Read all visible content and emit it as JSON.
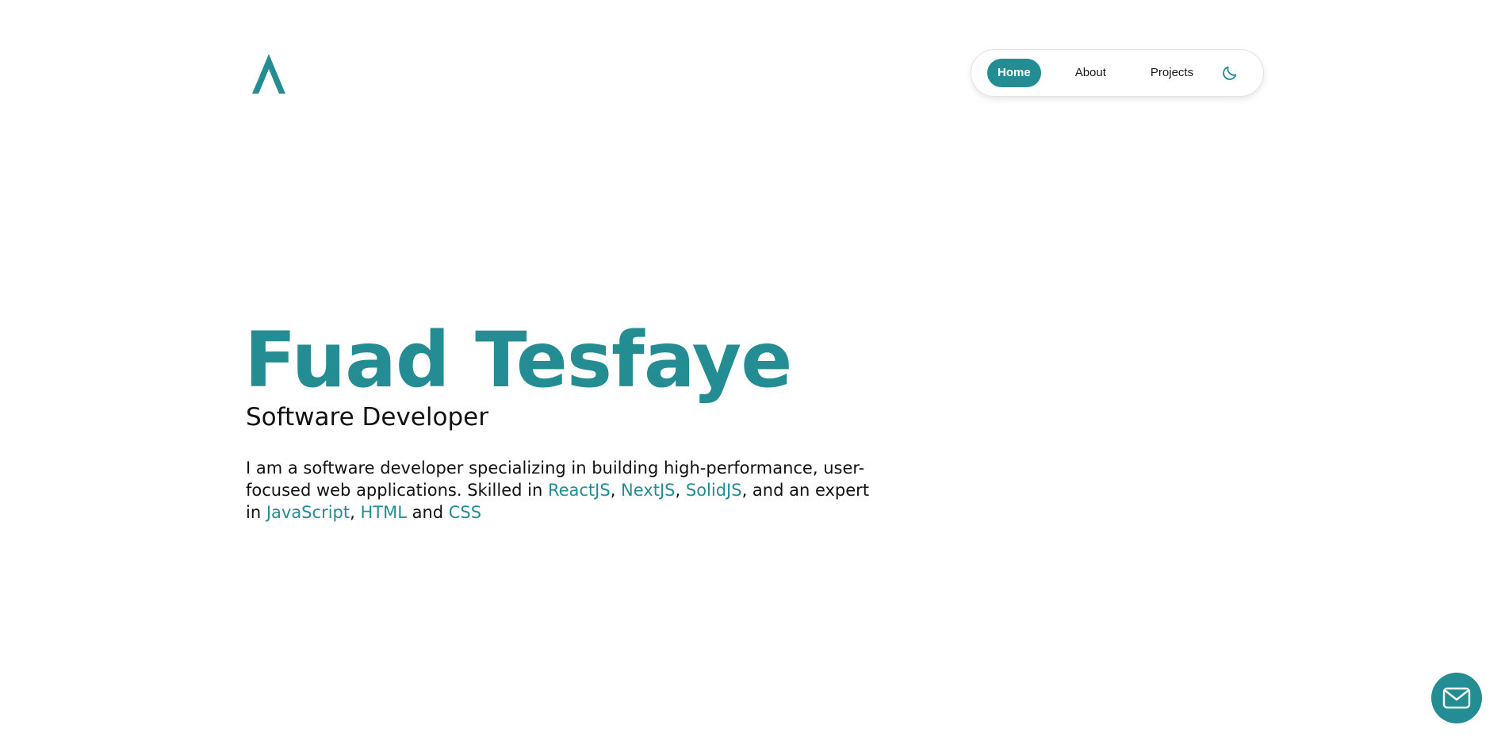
{
  "brand": {
    "logo_icon": "logo-a-icon",
    "accent_color": "#238d93"
  },
  "nav": {
    "items": [
      {
        "label": "Home",
        "active": true
      },
      {
        "label": "About",
        "active": false
      },
      {
        "label": "Projects",
        "active": false
      }
    ],
    "theme_toggle_icon": "moon-icon"
  },
  "hero": {
    "name": "Fuad Tesfaye",
    "role": "Software Developer",
    "bio": {
      "part1": "I am a software developer specializing in building high-performance, user-focused web applications. Skilled in ",
      "skill1": "ReactJS",
      "sep1": ", ",
      "skill2": "NextJS",
      "sep2": ", ",
      "skill3": "SolidJS",
      "part2": ", and an expert in ",
      "skill4": "JavaScript",
      "sep3": ", ",
      "skill5": "HTML",
      "part3": " and ",
      "skill6": "CSS"
    }
  },
  "contact": {
    "icon": "mail-icon"
  }
}
